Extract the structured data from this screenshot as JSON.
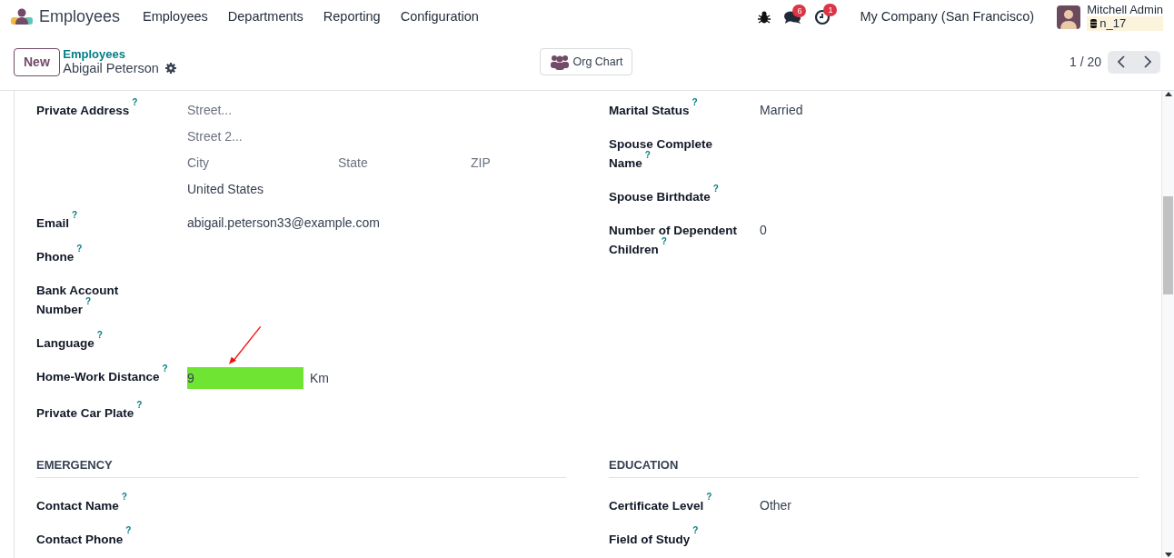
{
  "navbar": {
    "app_name": "Employees",
    "menu": [
      "Employees",
      "Departments",
      "Reporting",
      "Configuration"
    ],
    "systray": [
      {
        "kind": "bug"
      },
      {
        "kind": "chat",
        "badge": "6"
      },
      {
        "kind": "activity",
        "badge": "1"
      }
    ],
    "company": "My Company (San Francisco)",
    "user": {
      "name": "Mitchell Admin",
      "database": "n_17"
    }
  },
  "control_panel": {
    "new_button": "New",
    "breadcrumb": "Employees",
    "record_name": "Abigail Peterson",
    "org_chart_button": "Org Chart",
    "pager": "1 / 20"
  },
  "sections": [
    {
      "left": [
        {
          "kind": "address",
          "label": "Private Address",
          "help": "?",
          "street": {
            "placeholder": "Street..."
          },
          "street2": {
            "placeholder": "Street 2..."
          },
          "city": {
            "placeholder": "City"
          },
          "state": {
            "placeholder": "State"
          },
          "zip": {
            "placeholder": "ZIP"
          },
          "country": {
            "value": "United States"
          }
        },
        {
          "kind": "text",
          "label": "Email",
          "help": "?",
          "value": "abigail.peterson33@example.com"
        },
        {
          "kind": "text",
          "label": "Phone",
          "help": "?"
        },
        {
          "kind": "text",
          "label": "Bank Account Number",
          "help": "?"
        },
        {
          "kind": "text",
          "label": "Language",
          "help": "?"
        },
        {
          "kind": "distance",
          "label": "Home-Work Distance",
          "help": "?",
          "value": "9",
          "unit": "Km",
          "highlighted": true,
          "annotated": true
        },
        {
          "kind": "text",
          "label": "Private Car Plate",
          "help": "?"
        }
      ],
      "right": [
        {
          "kind": "text",
          "label": "Marital Status",
          "help": "?",
          "value": "Married"
        },
        {
          "kind": "text",
          "label": "Spouse Complete Name",
          "help": "?"
        },
        {
          "kind": "text",
          "label": "Spouse Birthdate",
          "help": "?"
        },
        {
          "kind": "text",
          "label": "Number of Dependent Children",
          "help": "?",
          "value": "0"
        }
      ]
    },
    {
      "left_title": "EMERGENCY",
      "right_title": "EDUCATION",
      "left": [
        {
          "kind": "text",
          "label": "Contact Name",
          "help": "?"
        },
        {
          "kind": "text",
          "label": "Contact Phone",
          "help": "?"
        }
      ],
      "right": [
        {
          "kind": "text",
          "label": "Certificate Level",
          "help": "?",
          "value": "Other"
        },
        {
          "kind": "text",
          "label": "Field of Study",
          "help": "?"
        }
      ]
    }
  ]
}
